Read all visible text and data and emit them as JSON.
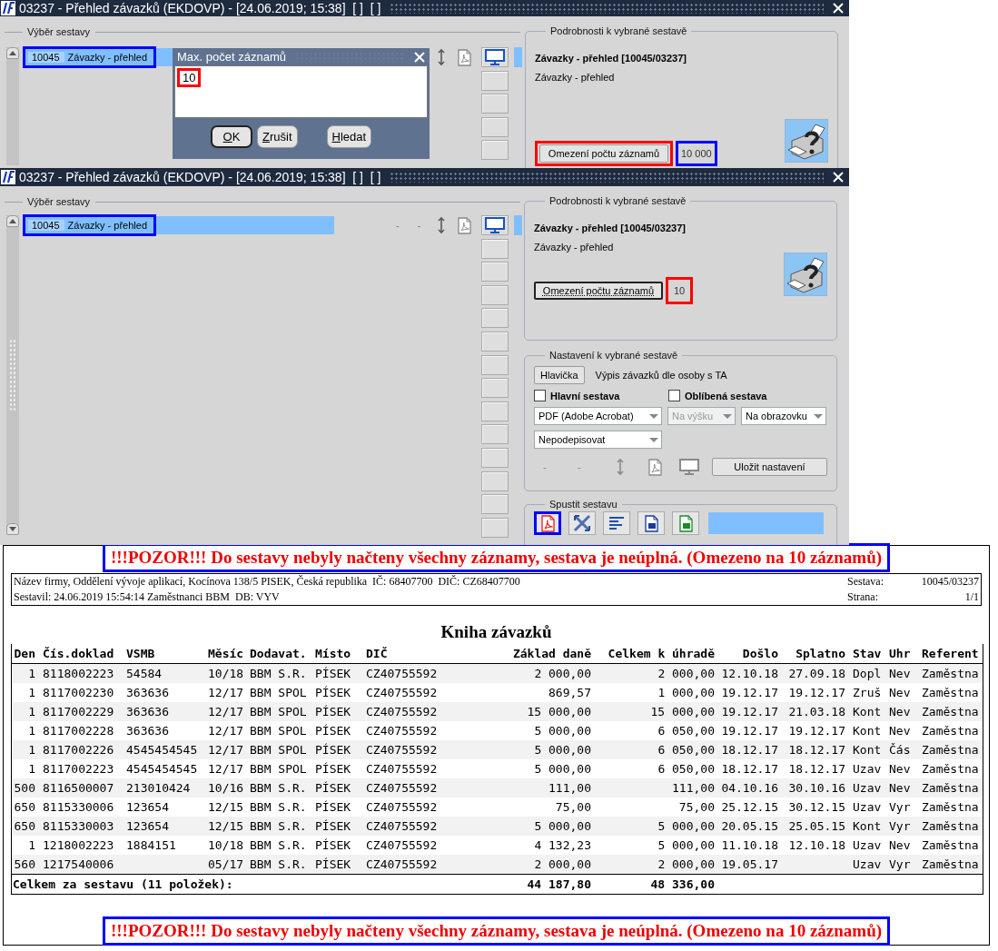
{
  "top_window": {
    "title": "03237 - Přehled závazků (EKDOVP) - [24.06.2019; 15:38]  [ ]  [ ]",
    "report_list": {
      "title": "Výběr sestavy",
      "rows": [
        {
          "code": "10045",
          "name": "Závazky - přehled",
          "selected": true,
          "highlight": {
            "color": "#0000ff"
          },
          "row_icons": [
            {
              "kind": "updown"
            },
            {
              "kind": "pdf"
            }
          ]
        }
      ],
      "side_buttons": [
        {
          "kind": "monitor"
        },
        {
          "kind": "blank"
        },
        {
          "kind": "blank"
        },
        {
          "kind": "blank"
        },
        {
          "kind": "blank"
        }
      ]
    },
    "details": {
      "title": "Podrobnosti k vybrané sestavě",
      "heading": "Závazky - přehled [10045/03237]",
      "description": "Závazky - přehled",
      "limit_button": {
        "label": "Omezení počtu záznamů",
        "highlight": {
          "color": "#ff0000"
        },
        "focused": false
      },
      "limit_value": {
        "value": "10 000",
        "highlight": {
          "color": "#0000ff"
        }
      }
    },
    "dialog": {
      "title": "Max. počet záznamů",
      "value": "10",
      "highlight": {
        "color": "#ff0000"
      },
      "buttons": [
        {
          "label": "OK",
          "focused": true
        },
        {
          "label": "Zrušit",
          "focused": false
        },
        {
          "label": "Hledat",
          "focused": false
        }
      ]
    }
  },
  "mid_window": {
    "title": "03237 - Přehled závazků (EKDOVP) - [24.06.2019; 15:38]  [ ]  [ ]",
    "report_list": {
      "title": "Výběr sestavy",
      "rows": [
        {
          "code": "10045",
          "name": "Závazky - přehled",
          "selected": true,
          "highlight": {
            "color": "#0000ff"
          },
          "dashes": [
            "-",
            "-"
          ],
          "row_icons": [
            {
              "kind": "updown"
            },
            {
              "kind": "pdf"
            }
          ]
        }
      ],
      "side_buttons": [
        {
          "kind": "monitor"
        },
        {
          "kind": "blank"
        },
        {
          "kind": "blank"
        },
        {
          "kind": "blank"
        },
        {
          "kind": "blank"
        },
        {
          "kind": "blank"
        },
        {
          "kind": "blank"
        },
        {
          "kind": "blank"
        },
        {
          "kind": "blank"
        },
        {
          "kind": "blank"
        },
        {
          "kind": "blank"
        },
        {
          "kind": "blank"
        },
        {
          "kind": "blank"
        },
        {
          "kind": "blank"
        }
      ]
    },
    "details": {
      "title": "Podrobnosti k vybrané sestavě",
      "heading": "Závazky - přehled [10045/03237]",
      "description": "Závazky - přehled",
      "limit_button": {
        "label": "Omezení počtu záznamů",
        "focused": true
      },
      "limit_value": {
        "value": "10",
        "highlight": {
          "color": "#ff0000"
        }
      }
    },
    "settings": {
      "title": "Nastavení k vybrané sestavě",
      "header_button": "Hlavička",
      "header_text": "Výpis závazků dle osoby s TA",
      "checkboxes": [
        {
          "label": "Hlavní sestava",
          "checked": false
        },
        {
          "label": "Oblíbená sestava",
          "checked": false
        }
      ],
      "selects": [
        {
          "value": "PDF (Adobe Acrobat)",
          "disabled": false
        },
        {
          "value": "Na výšku",
          "disabled": true
        },
        {
          "value": "Na obrazovku",
          "disabled": false
        },
        {
          "value": "Nepodepisovat",
          "disabled": false
        }
      ],
      "dashes": [
        "-",
        "-"
      ],
      "icons": [
        {
          "kind": "updown"
        },
        {
          "kind": "pdf"
        },
        {
          "kind": "monitor"
        }
      ],
      "save_button": "Uložit nastavení"
    },
    "run": {
      "title": "Spustit sestavu",
      "buttons": [
        {
          "kind": "pdf",
          "highlight": {
            "color": "#0000ff"
          }
        },
        {
          "kind": "crossed"
        },
        {
          "kind": "lines"
        },
        {
          "kind": "word"
        },
        {
          "kind": "excel"
        }
      ]
    }
  },
  "report": {
    "warning_top": {
      "text": "!!!POZOR!!! Do sestavy nebyly načteny všechny záznamy, sestava je neúplná. (Omezeno na 10 záznamů)",
      "highlight": {
        "color": "#0000ff"
      }
    },
    "header": {
      "company": "Název firmy, Oddělení vývoje aplikací, Kocínova 138/5 PISEK, Česká republika  IČ: 68407700  DIČ: CZ68407700",
      "author": "Sestavil: 24.06.2019 15:54:14 Zaměstnanci BBM  DB: VYV",
      "fields": [
        {
          "label": "Sestava:",
          "value": "10045/03237"
        },
        {
          "label": "Strana:",
          "value": "1/1"
        }
      ]
    },
    "title": "Kniha závazků",
    "table": {
      "columns": [
        {
          "label": "Den",
          "numeric": true
        },
        {
          "label": "Čís.doklad",
          "numeric": false
        },
        {
          "label": "VSMB",
          "numeric": false
        },
        {
          "label": "Měsíc",
          "numeric": false
        },
        {
          "label": "Dodavat.",
          "numeric": false
        },
        {
          "label": "Místo",
          "numeric": false
        },
        {
          "label": "DIČ",
          "numeric": false
        },
        {
          "label": "Základ daně",
          "numeric": true
        },
        {
          "label": "Celkem k úhradě",
          "numeric": true
        },
        {
          "label": "Došlo",
          "numeric": true
        },
        {
          "label": "Splatno",
          "numeric": true
        },
        {
          "label": "Stav",
          "numeric": false
        },
        {
          "label": "Uhr",
          "numeric": false
        },
        {
          "label": "Referent",
          "numeric": false
        }
      ],
      "rows": [
        [
          "1",
          "8118002223",
          "54584",
          "10/18",
          "BBM S.R.",
          "PÍSEK",
          "CZ40755592",
          "2 000,00",
          "2 000,00",
          "12.10.18",
          "27.09.18",
          "Dopl",
          "Nev",
          "Zaměstna"
        ],
        [
          "1",
          "8117002230",
          "363636",
          "12/17",
          "BBM SPOL",
          "PÍSEK",
          "CZ40755592",
          "869,57",
          "1 000,00",
          "19.12.17",
          "19.12.17",
          "Zruš",
          "Nev",
          "Zaměstna"
        ],
        [
          "1",
          "8117002229",
          "363636",
          "12/17",
          "BBM SPOL",
          "PÍSEK",
          "CZ40755592",
          "15 000,00",
          "15 000,00",
          "19.12.17",
          "21.03.18",
          "Kont",
          "Nev",
          "Zaměstna"
        ],
        [
          "1",
          "8117002228",
          "363636",
          "12/17",
          "BBM SPOL",
          "PÍSEK",
          "CZ40755592",
          "5 000,00",
          "6 050,00",
          "19.12.17",
          "19.12.17",
          "Kont",
          "Nev",
          "Zaměstna"
        ],
        [
          "1",
          "8117002226",
          "4545454545",
          "12/17",
          "BBM SPOL",
          "PÍSEK",
          "CZ40755592",
          "5 000,00",
          "6 050,00",
          "18.12.17",
          "18.12.17",
          "Kont",
          "Čás",
          "Zaměstna"
        ],
        [
          "1",
          "8117002223",
          "4545454545",
          "12/17",
          "BBM SPOL",
          "PÍSEK",
          "CZ40755592",
          "5 000,00",
          "6 050,00",
          "18.12.17",
          "18.12.17",
          "Uzav",
          "Nev",
          "Zaměstna"
        ],
        [
          "500",
          "8116500007",
          "213010424",
          "10/16",
          "BBM S.R.",
          "PÍSEK",
          "CZ40755592",
          "111,00",
          "111,00",
          "04.10.16",
          "30.10.16",
          "Uzav",
          "Nev",
          "Zaměstna"
        ],
        [
          "650",
          "8115330006",
          "123654",
          "12/15",
          "BBM S.R.",
          "PÍSEK",
          "CZ40755592",
          "75,00",
          "75,00",
          "25.12.15",
          "30.12.15",
          "Uzav",
          "Vyr",
          "Zaměstna"
        ],
        [
          "650",
          "8115330003",
          "123654",
          "12/15",
          "BBM S.R.",
          "PÍSEK",
          "CZ40755592",
          "5 000,00",
          "5 000,00",
          "20.05.15",
          "25.05.15",
          "Kont",
          "Vyr",
          "Zaměstna"
        ],
        [
          "1",
          "1218002223",
          "1884151",
          "10/18",
          "BBM S.R.",
          "PÍSEK",
          "CZ40755592",
          "4 132,23",
          "5 000,00",
          "11.10.18",
          "12.10.18",
          "Uzav",
          "Nev",
          "Zaměstna"
        ],
        [
          "560",
          "1217540006",
          null,
          "05/17",
          "BBM S.R.",
          "PÍSEK",
          "CZ40755592",
          "2 000,00",
          "2 000,00",
          "19.05.17",
          null,
          "Uzav",
          "Vyr",
          "Zaměstna"
        ]
      ],
      "total": {
        "label": "Celkem za sestavu (11 položek):",
        "values": [
          "44 187,80",
          "48 336,00"
        ]
      }
    },
    "warning_bottom": {
      "text": "!!!POZOR!!! Do sestavy nebyly načteny všechny záznamy, sestava je neúplná. (Omezeno na 10 záznamů)",
      "highlight": {
        "color": "#0000ff"
      }
    }
  }
}
